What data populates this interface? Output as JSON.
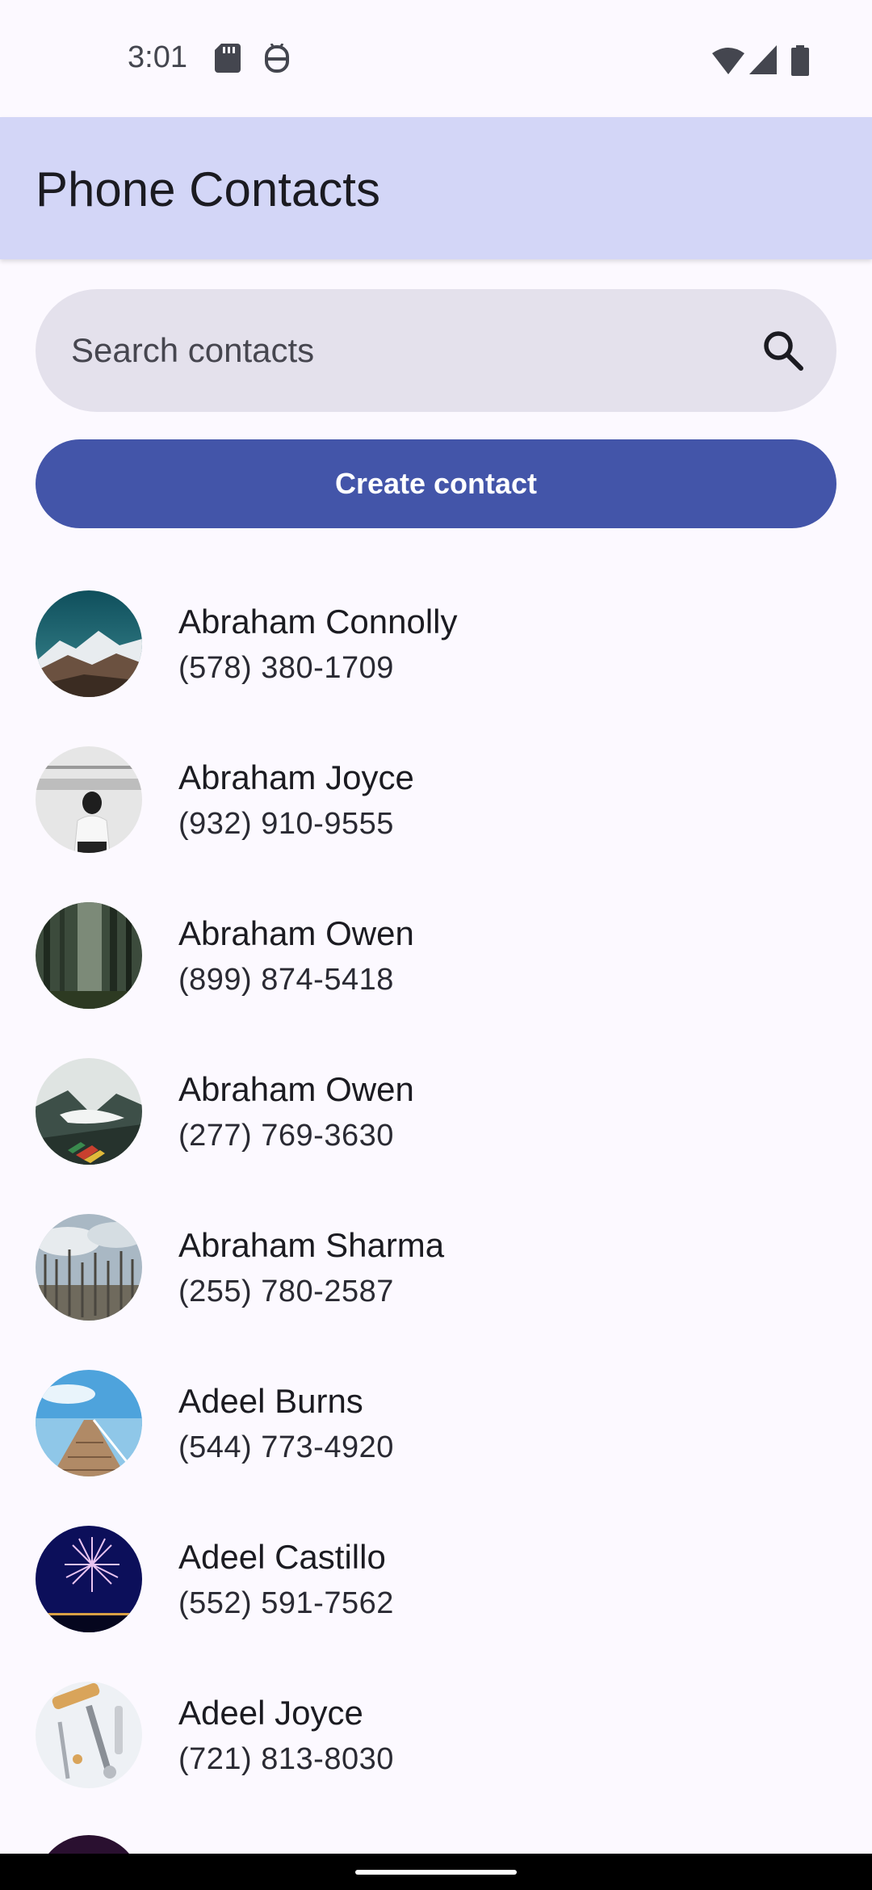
{
  "status_bar": {
    "time": "3:01",
    "icons_left": [
      "sd-card-icon",
      "debug-icon"
    ],
    "icons_right": [
      "wifi-icon",
      "signal-icon",
      "battery-icon"
    ]
  },
  "app_bar": {
    "title": "Phone Contacts"
  },
  "search": {
    "placeholder": "Search contacts",
    "value": "",
    "icon": "search-icon"
  },
  "actions": {
    "create_label": "Create contact"
  },
  "contacts": [
    {
      "name": "Abraham Connolly",
      "phone": "(578) 380-1709",
      "avatar": "mountain-photo"
    },
    {
      "name": "Abraham Joyce",
      "phone": "(932) 910-9555",
      "avatar": "woman-station-photo"
    },
    {
      "name": "Abraham Owen",
      "phone": "(899) 874-5418",
      "avatar": "forest-photo"
    },
    {
      "name": "Abraham Owen",
      "phone": "(277) 769-3630",
      "avatar": "misty-valley-photo"
    },
    {
      "name": "Abraham Sharma",
      "phone": "(255) 780-2587",
      "avatar": "bare-trees-photo"
    },
    {
      "name": "Adeel Burns",
      "phone": "(544) 773-4920",
      "avatar": "pier-photo"
    },
    {
      "name": "Adeel Castillo",
      "phone": "(552) 591-7562",
      "avatar": "fireworks-photo"
    },
    {
      "name": "Adeel Joyce",
      "phone": "(721) 813-8030",
      "avatar": "tools-photo"
    }
  ],
  "colors": {
    "app_bar": "#d3d6f7",
    "primary": "#4355a9",
    "search_bg": "#e4e1ec",
    "background": "#fcf9ff"
  }
}
